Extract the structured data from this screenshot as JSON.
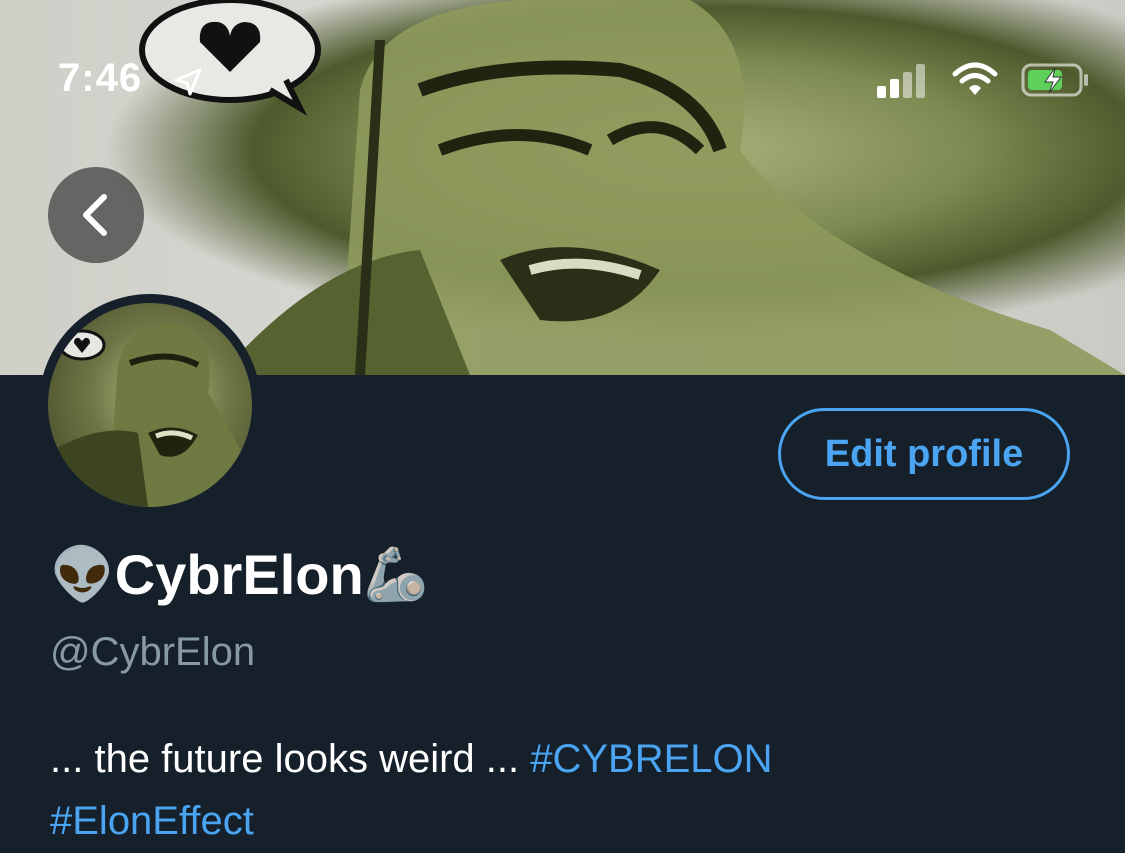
{
  "status_bar": {
    "time": "7:46",
    "icons": [
      "location-arrow-icon",
      "cellular-signal-icon",
      "wifi-icon",
      "battery-charging-icon"
    ]
  },
  "banner": {
    "description_icon": "header-image"
  },
  "profile": {
    "name": "CybrElon",
    "name_prefix_emoji": "👽",
    "name_suffix_emoji": "🦾",
    "handle": "@CybrElon",
    "bio_text": "... the future looks weird ... ",
    "bio_hashtags": [
      "#CYBRELON",
      "#ElonEffect"
    ]
  },
  "actions": {
    "edit_profile_label": "Edit profile"
  },
  "colors": {
    "background": "#15202b",
    "accent": "#4aa4f2",
    "muted": "#8899a6"
  }
}
